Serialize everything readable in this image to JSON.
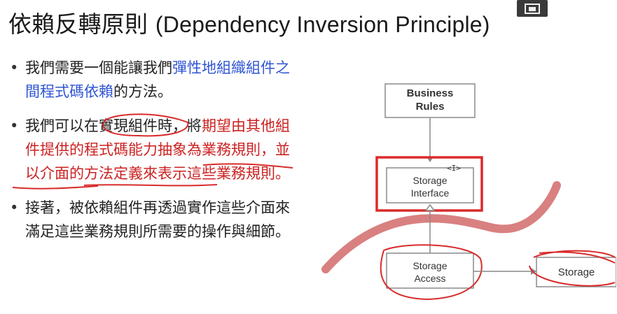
{
  "slide": {
    "title_cjk": "依賴反轉原則",
    "title_latin": "(Dependency Inversion Principle)",
    "bullets": [
      {
        "a": "我們需要一個能讓我們",
        "b_blue": "彈性地組織組件之間程式碼依賴",
        "c": "的方法。"
      },
      {
        "a": "我們可以在實現組件時，將",
        "b_red": "期望由其他組件提供的程式碼能力抽象為業務規則，並以介面的方法定義來表示這些業務規則",
        "c": "。"
      },
      {
        "a": "接著，被依賴組件再透過實作這些介面來滿足這些業務規則所需要的操作與細節。"
      }
    ]
  },
  "diagram": {
    "business_rules_line1": "Business",
    "business_rules_line2": "Rules",
    "interface_tag": "<I>",
    "storage_interface_line1": "Storage",
    "storage_interface_line2": "Interface",
    "storage_access_line1": "Storage",
    "storage_access_line2": "Access",
    "storage": "Storage"
  },
  "colors": {
    "annotation_red": "#d92b2b",
    "boundary_band": "#d98080",
    "link_blue": "#2f55d4"
  }
}
